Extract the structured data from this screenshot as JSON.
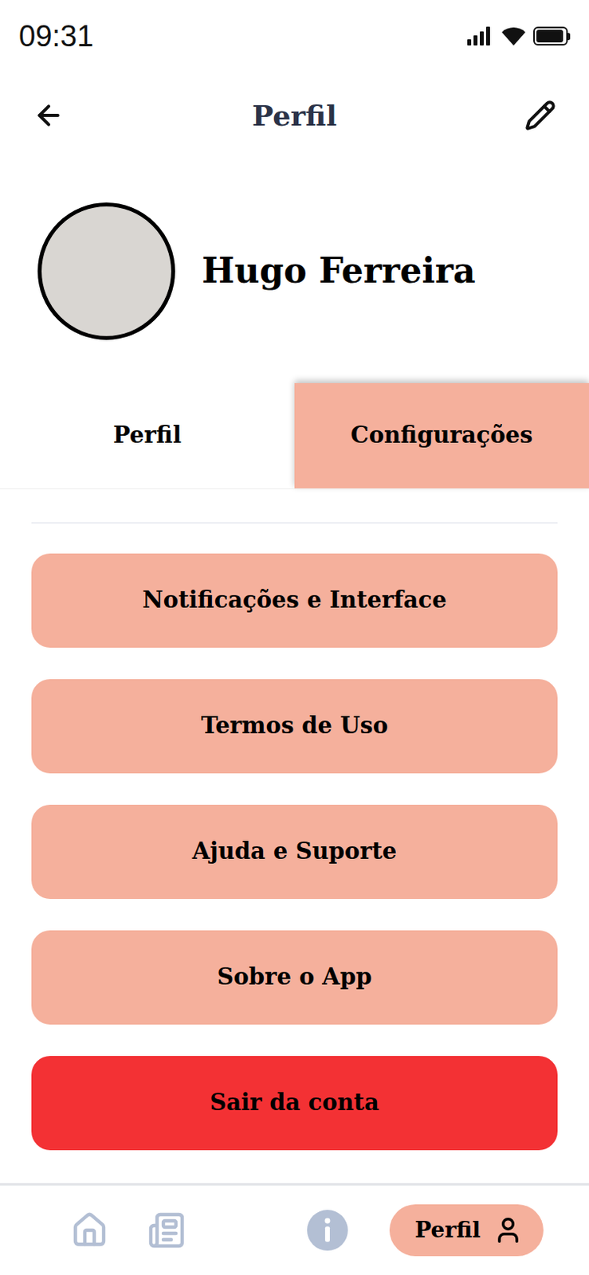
{
  "status_bar": {
    "time": "09:31",
    "battery": {
      "level": 0.95
    }
  },
  "header": {
    "title": "Perfil"
  },
  "profile": {
    "name": "Hugo Ferreira"
  },
  "tabs": [
    {
      "label": "Perfil",
      "selected": false
    },
    {
      "label": "Configurações",
      "selected": true
    }
  ],
  "settings": [
    {
      "label": "Notificações e Interface",
      "kind": "option"
    },
    {
      "label": "Termos de Uso",
      "kind": "option"
    },
    {
      "label": "Ajuda e Suporte",
      "kind": "option"
    },
    {
      "label": "Sobre o App",
      "kind": "option"
    },
    {
      "label": "Sair da conta",
      "kind": "danger"
    }
  ],
  "bottom_nav": [
    {
      "label": "",
      "selected": false
    },
    {
      "label": "",
      "selected": false
    },
    {
      "label": "",
      "selected": false
    },
    {
      "label": "Perfil",
      "selected": true
    }
  ]
}
